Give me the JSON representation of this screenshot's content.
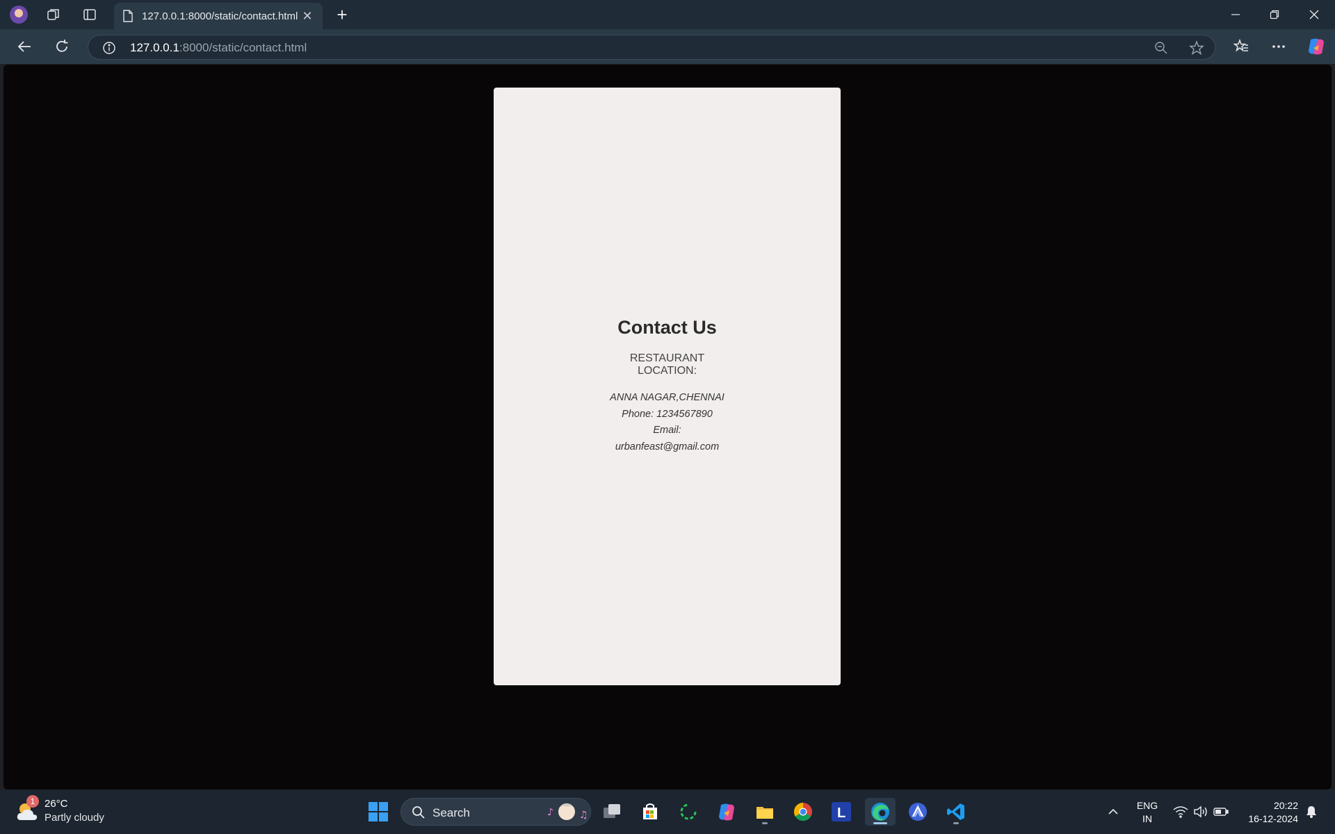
{
  "browser": {
    "tab_title": "127.0.0.1:8000/static/contact.html",
    "url_host": "127.0.0.1",
    "url_rest": ":8000/static/contact.html",
    "new_tab": "+"
  },
  "page": {
    "heading": "Contact Us",
    "location_label_line1": "RESTAURANT",
    "location_label_line2": "LOCATION:",
    "address": "ANNA NAGAR,CHENNAI",
    "phone": "Phone: 1234567890",
    "email_label": "Email:",
    "email": "urbanfeast@gmail.com"
  },
  "taskbar": {
    "weather_temp": "26°C",
    "weather_condition": "Partly cloudy",
    "weather_badge": "1",
    "search_label": "Search",
    "lang_line1": "ENG",
    "lang_line2": "IN",
    "time": "20:22",
    "date": "16-12-2024"
  },
  "colors": {
    "page_background": "#080607",
    "card_background": "#f2eeed",
    "chrome": "#2b3a47"
  }
}
